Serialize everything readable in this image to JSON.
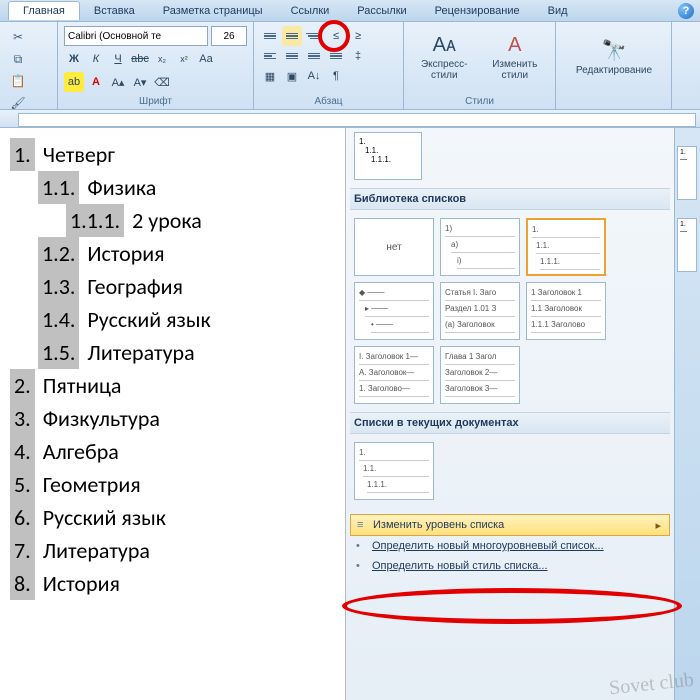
{
  "tabs": {
    "main": "Главная",
    "insert": "Вставка",
    "layout": "Разметка страницы",
    "refs": "Ссылки",
    "mail": "Рассылки",
    "review": "Рецензирование",
    "view": "Вид"
  },
  "font": {
    "name": "Calibri (Основной те",
    "size": "26"
  },
  "groups": {
    "font": "Шрифт",
    "paragraph": "Абзац",
    "styles": "Стили",
    "editing": "Редактирование"
  },
  "styles_btns": {
    "quick": "Экспресс-стили",
    "change": "Изменить стили"
  },
  "document_list": [
    {
      "level": 0,
      "num": "1.",
      "text": "Четверг",
      "numSel": true
    },
    {
      "level": 1,
      "num": "1.1.",
      "text": "Физика",
      "numSel": true
    },
    {
      "level": 2,
      "num": "1.1.1.",
      "text": "2 урока",
      "numSel": true
    },
    {
      "level": 1,
      "num": "1.2.",
      "text": "История",
      "numSel": true
    },
    {
      "level": 1,
      "num": "1.3.",
      "text": "География",
      "numSel": true
    },
    {
      "level": 1,
      "num": "1.4.",
      "text": "Русский язык",
      "numSel": true
    },
    {
      "level": 1,
      "num": "1.5.",
      "text": "Литература",
      "numSel": true
    },
    {
      "level": 0,
      "num": "2.",
      "text": "Пятница",
      "numSel": true
    },
    {
      "level": 0,
      "num": "3.",
      "text": "Физкультура",
      "numSel": true
    },
    {
      "level": 0,
      "num": "4.",
      "text": "Алгебра",
      "numSel": true
    },
    {
      "level": 0,
      "num": "5.",
      "text": "Геометрия",
      "numSel": true
    },
    {
      "level": 0,
      "num": "6.",
      "text": "Русский язык",
      "numSel": true
    },
    {
      "level": 0,
      "num": "7.",
      "text": "Литература",
      "numSel": true
    },
    {
      "level": 0,
      "num": "8.",
      "text": "История",
      "numSel": true
    }
  ],
  "gallery": {
    "library_title": "Библиотека списков",
    "current_title": "Списки в текущих документах",
    "none": "нет",
    "tiles": {
      "t2": [
        "1)",
        "a)",
        "i)"
      ],
      "t3": [
        "1.",
        "1.1.",
        "1.1.1."
      ],
      "t5": [
        "Статья I. Заго",
        "Раздел 1.01 З",
        "(a) Заголовок"
      ],
      "t6": [
        "1 Заголовок 1",
        "1.1 Заголовок",
        "1.1.1 Заголово"
      ],
      "t7": [
        "I. Заголовок 1—",
        "A. Заголовок—",
        "1. Заголово—"
      ],
      "t8": [
        "Глава 1 Загол",
        "Заголовок 2—",
        "Заголовок 3—"
      ],
      "current": [
        "1.",
        "1.1.",
        "1.1.1."
      ]
    },
    "menu": {
      "change_level": "Изменить уровень списка",
      "define_new": "Определить новый многоуровневый список...",
      "define_style": "Определить новый стиль списка..."
    }
  },
  "preview_small": [
    "1.",
    "1.1.",
    "1.1.1."
  ],
  "watermark": "Sovet club"
}
